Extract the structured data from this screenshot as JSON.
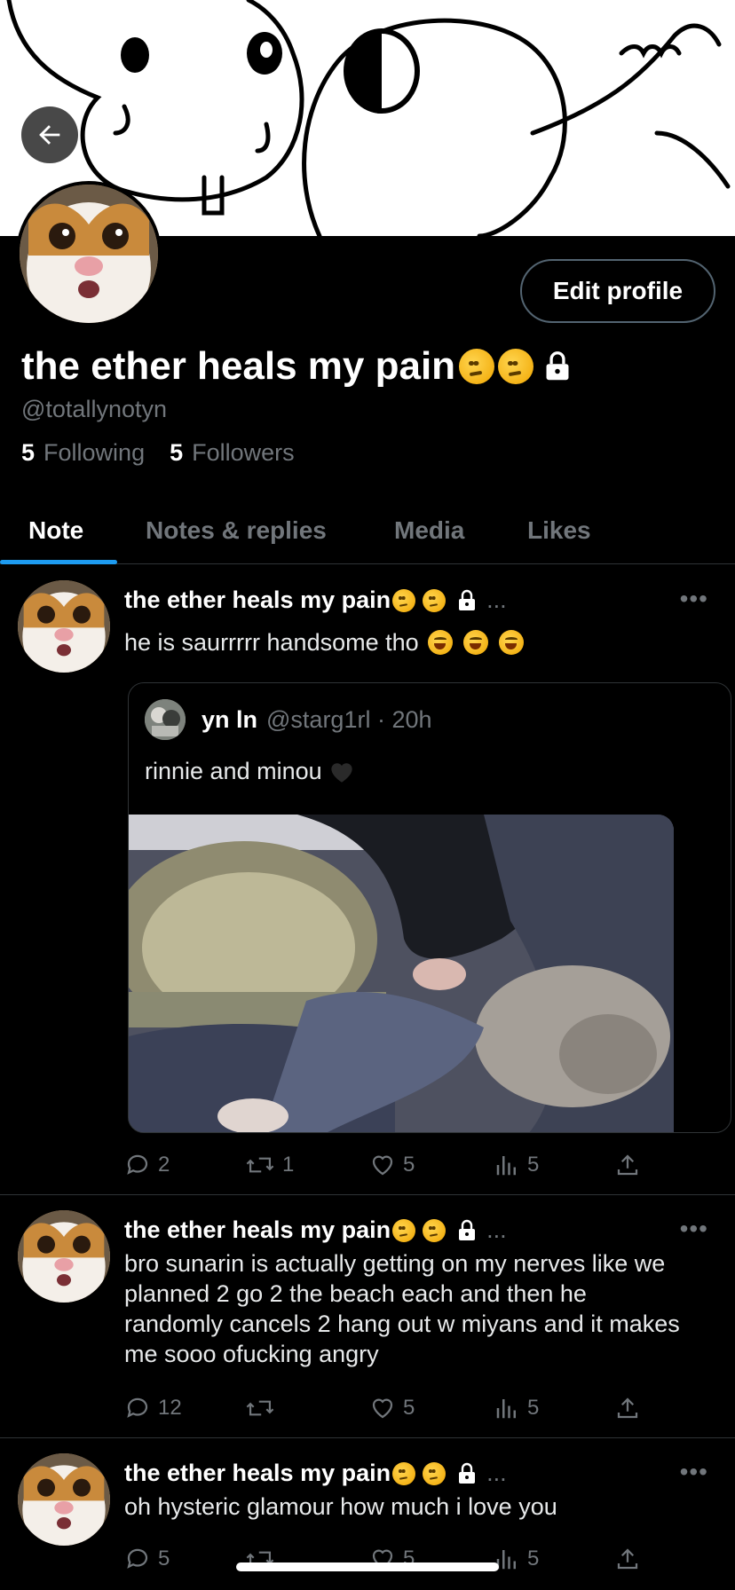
{
  "profile": {
    "name": "the ether heals my pain",
    "handle": "@totallynotyn",
    "following_count": "5",
    "following_label": "Following",
    "followers_count": "5",
    "followers_label": "Followers",
    "edit_label": "Edit profile"
  },
  "tabs": [
    {
      "label": "Note",
      "active": true
    },
    {
      "label": "Notes & replies",
      "active": false
    },
    {
      "label": "Media",
      "active": false
    },
    {
      "label": "Likes",
      "active": false
    }
  ],
  "posts": [
    {
      "author": "the ether heals my pain",
      "ellipsis": "...",
      "text": "he is saurrrrr handsome tho",
      "replies": "2",
      "reposts": "1",
      "likes": "5",
      "views": "5"
    },
    {
      "author": "the ether heals my pain",
      "ellipsis": "...",
      "text": "bro sunarin is actually getting on my nerves like we planned 2 go 2 the beach each and then he randomly cancels 2 hang out w miyans and it makes me sooo ofucking angry",
      "replies": "12",
      "reposts": "",
      "likes": "5",
      "views": "5"
    },
    {
      "author": "the ether heals my pain",
      "ellipsis": "...",
      "text": "oh hysteric glamour how much i love you",
      "replies": "5",
      "reposts": "",
      "likes": "5",
      "views": "5"
    }
  ],
  "quote": {
    "name": "yn ln",
    "meta": "@starg1rl · 20h",
    "text": "rinnie and minou"
  },
  "colors": {
    "accent": "#1d9bf0",
    "muted": "#71767b",
    "divider": "#2f3336"
  }
}
